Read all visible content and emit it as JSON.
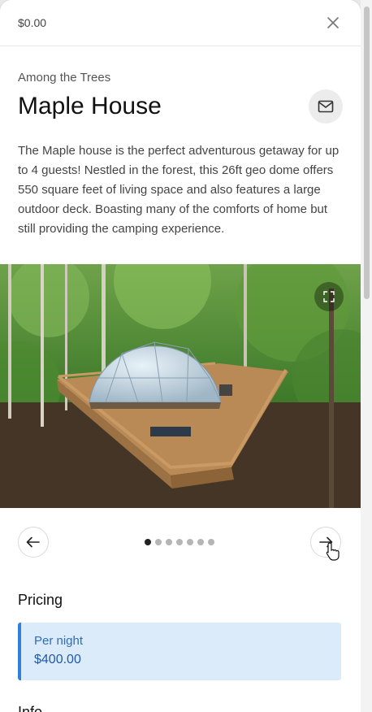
{
  "header": {
    "price": "$0.00",
    "close_icon": "close-icon"
  },
  "listing": {
    "subtitle": "Among the Trees",
    "title": "Maple House",
    "contact_icon": "mail-icon",
    "description": "The Maple house is the perfect adventurous getaway for up to 4 guests! Nestled in the forest, this 26ft geo dome offers 550 square feet of living space and also features a large outdoor deck. Boasting many of the comforts of home but still providing the camping experience."
  },
  "gallery": {
    "photo": "geodesic dome on wooden deck in forest",
    "expand_icon": "expand-icon",
    "prev_icon": "arrow-left-icon",
    "next_icon": "arrow-right-icon",
    "slide_count": 7,
    "active_slide": 1
  },
  "pricing": {
    "title": "Pricing",
    "label": "Per night",
    "value": "$400.00",
    "accent": "#2f80d9"
  },
  "next_section": {
    "title": "Info"
  }
}
